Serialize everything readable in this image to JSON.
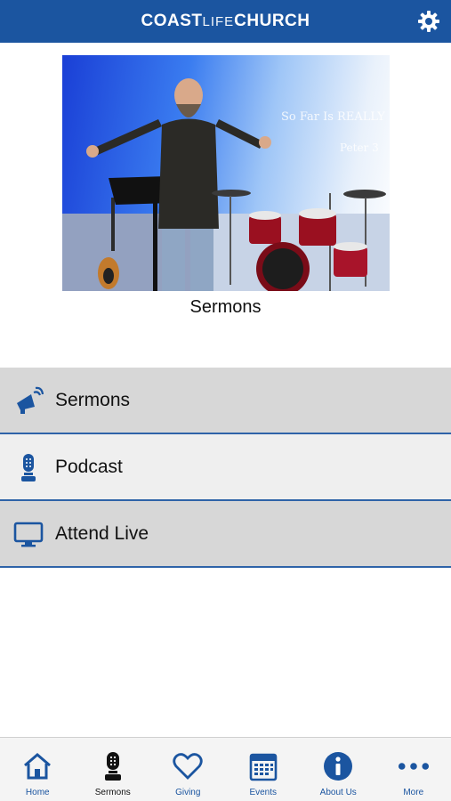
{
  "header": {
    "logo_part1": "COAST",
    "logo_part2": "LIFE",
    "logo_part3": "CHURCH",
    "settings_icon": "gear-icon"
  },
  "hero": {
    "caption": "Sermons",
    "overlay_text1": "So Far Is REALLY",
    "overlay_text2": "Peter 3"
  },
  "menu": {
    "items": [
      {
        "label": "Sermons",
        "icon": "megaphone-icon"
      },
      {
        "label": "Podcast",
        "icon": "microphone-icon"
      },
      {
        "label": "Attend Live",
        "icon": "monitor-icon"
      }
    ]
  },
  "tabbar": {
    "tabs": [
      {
        "label": "Home",
        "icon": "home-icon"
      },
      {
        "label": "Sermons",
        "icon": "microphone-icon"
      },
      {
        "label": "Giving",
        "icon": "heart-icon"
      },
      {
        "label": "Events",
        "icon": "calendar-icon"
      },
      {
        "label": "About Us",
        "icon": "info-icon"
      },
      {
        "label": "More",
        "icon": "more-icon"
      }
    ],
    "active": "Sermons"
  },
  "colors": {
    "brand_blue": "#1b55a0",
    "row_gray": "#d7d7d7",
    "row_light": "#efefef"
  }
}
